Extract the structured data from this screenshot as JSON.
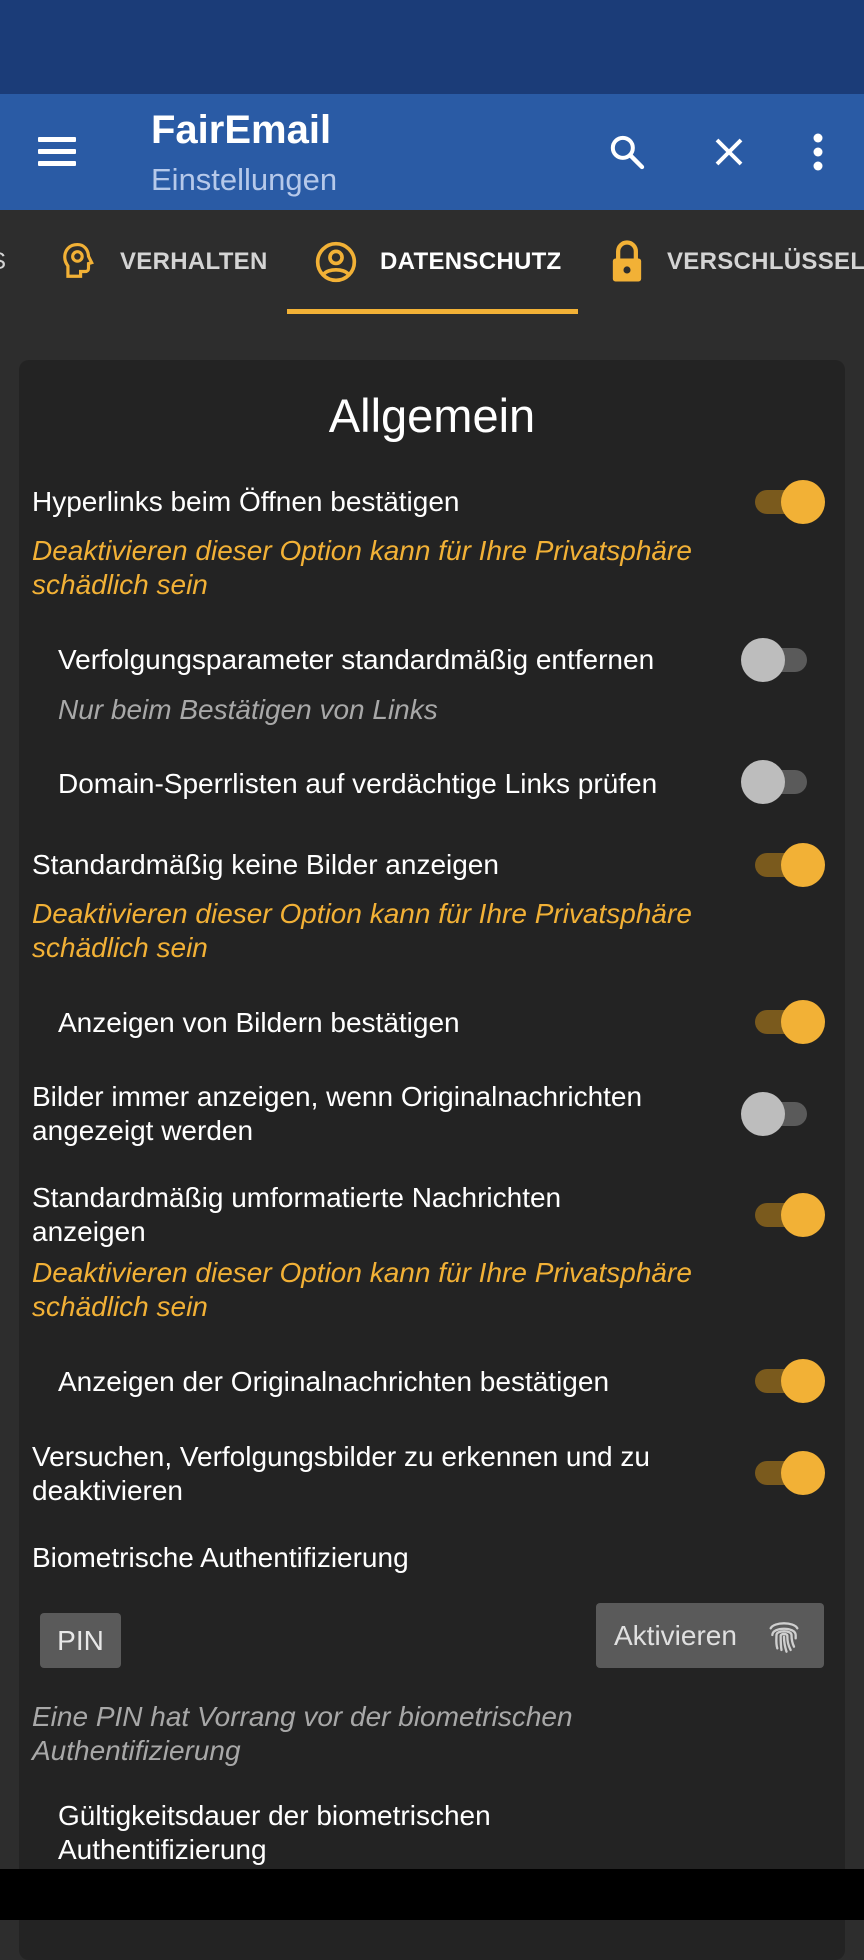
{
  "app": {
    "title": "FairEmail",
    "subtitle": "Einstellungen"
  },
  "toolbar": {
    "menu_icon": "hamburger-menu-icon",
    "search_icon": "search-icon",
    "close_icon": "close-icon",
    "more_icon": "more-vert-icon"
  },
  "tabs": [
    {
      "label": "S",
      "icon": "none",
      "active": false
    },
    {
      "label": "VERHALTEN",
      "icon": "head-gear-icon",
      "active": false
    },
    {
      "label": "DATENSCHUTZ",
      "icon": "account-circle-icon",
      "active": true
    },
    {
      "label": "VERSCHLÜSSELU",
      "icon": "lock-icon",
      "active": false
    }
  ],
  "section": {
    "title": "Allgemein"
  },
  "settings": {
    "confirm_links": {
      "label": "Hyperlinks beim Öffnen bestätigen",
      "on": true
    },
    "confirm_links_warning": "Deaktivieren dieser Option kann für Ihre Privatsphäre schädlich sein",
    "remove_tracking": {
      "label": "Verfolgungsparameter standardmäßig entfernen",
      "on": false
    },
    "remove_tracking_hint": "Nur beim Bestätigen von Links",
    "domain_blocklists": {
      "label": "Domain-Sperrlisten auf verdächtige Links prüfen",
      "on": false
    },
    "no_images": {
      "label": "Standardmäßig keine Bilder anzeigen",
      "on": true
    },
    "no_images_warning": "Deaktivieren dieser Option kann für Ihre Privatsphäre schädlich sein",
    "confirm_images": {
      "label": "Anzeigen von Bildern bestätigen",
      "on": true
    },
    "always_images": {
      "label": "Bilder immer anzeigen, wenn Originalnachrichten angezeigt werden",
      "on": false
    },
    "reformatted": {
      "label": "Standardmäßig umformatierte Nachrichten anzeigen",
      "on": true
    },
    "reformatted_warning": "Deaktivieren dieser Option kann für Ihre Privatsphäre schädlich sein",
    "confirm_original": {
      "label": "Anzeigen der Originalnachrichten bestätigen",
      "on": true
    },
    "tracking_images": {
      "label": "Versuchen, Verfolgungsbilder zu erkennen und zu deaktivieren",
      "on": true
    },
    "biometrics": {
      "label": "Biometrische Authentifizierung"
    },
    "pin_button": "PIN",
    "activate_button": "Aktivieren",
    "activate_icon": "fingerprint-icon",
    "pin_hint": "Eine PIN hat Vorrang vor der biometrischen Authentifizierung",
    "biometrics_timeout": {
      "label": "Gültigkeitsdauer der biometrischen Authentifizierung"
    }
  },
  "colors": {
    "statusbar": "#1b3c78",
    "appbar": "#2a5ba5",
    "accent": "#f2b136",
    "background": "#2d2d2d",
    "card": "#232323"
  }
}
